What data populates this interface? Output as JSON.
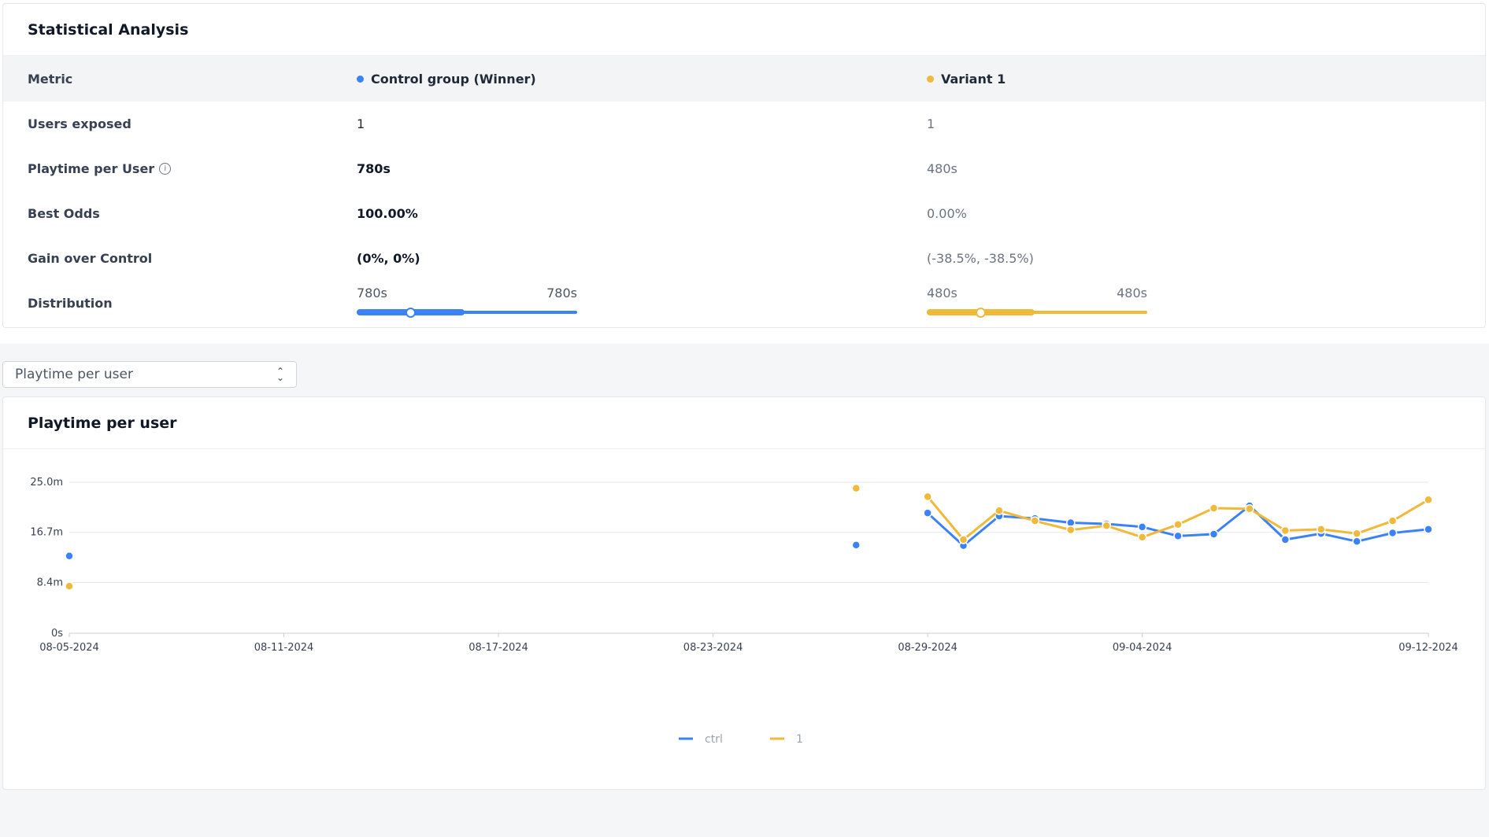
{
  "stats": {
    "title": "Statistical Analysis",
    "header": {
      "metric": "Metric",
      "control": "Control group (Winner)",
      "variant": "Variant 1"
    },
    "rows": [
      {
        "label": "Users exposed",
        "control": "1",
        "variant": "1"
      },
      {
        "label": "Playtime per User",
        "control": "780s",
        "variant": "480s"
      },
      {
        "label": "Best Odds",
        "control": "100.00%",
        "variant": "0.00%"
      },
      {
        "label": "Gain over Control",
        "control": "(0%, 0%)",
        "variant": "(-38.5%, -38.5%)"
      }
    ],
    "distribution": {
      "label": "Distribution",
      "control": {
        "low": "780s",
        "high": "780s"
      },
      "variant": {
        "low": "480s",
        "high": "480s"
      }
    }
  },
  "colors": {
    "control": "#3b82f6",
    "variant": "#f0b93a"
  },
  "select": {
    "value": "Playtime per user"
  },
  "chart": {
    "title": "Playtime per user"
  },
  "chart_data": {
    "type": "line",
    "title": "Playtime per user",
    "xlabel": "",
    "ylabel": "",
    "x_ticks": [
      "08-05-2024",
      "08-11-2024",
      "08-17-2024",
      "08-23-2024",
      "08-29-2024",
      "09-04-2024",
      "09-12-2024"
    ],
    "y_ticks": [
      "0s",
      "8.4m",
      "16.7m",
      "25.0m"
    ],
    "ylim": [
      0,
      25.0
    ],
    "y_unit": "m",
    "grid": true,
    "legend_position": "bottom-center",
    "series": [
      {
        "name": "ctrl",
        "points": [
          [
            "08-05-2024",
            12.8
          ],
          [
            "08-27-2024",
            14.6
          ],
          [
            "08-29-2024",
            19.9
          ],
          [
            "08-30-2024",
            14.5
          ],
          [
            "08-31-2024",
            19.4
          ],
          [
            "09-01-2024",
            19.0
          ],
          [
            "09-02-2024",
            18.3
          ],
          [
            "09-03-2024",
            18.1
          ],
          [
            "09-04-2024",
            17.6
          ],
          [
            "09-05-2024",
            16.1
          ],
          [
            "09-06-2024",
            16.4
          ],
          [
            "09-07-2024",
            21.1
          ],
          [
            "09-08-2024",
            15.5
          ],
          [
            "09-09-2024",
            16.5
          ],
          [
            "09-10-2024",
            15.2
          ],
          [
            "09-11-2024",
            16.6
          ],
          [
            "09-12-2024",
            17.2
          ]
        ]
      },
      {
        "name": "1",
        "points": [
          [
            "08-05-2024",
            7.8
          ],
          [
            "08-27-2024",
            24.0
          ],
          [
            "08-29-2024",
            22.6
          ],
          [
            "08-30-2024",
            15.5
          ],
          [
            "08-31-2024",
            20.3
          ],
          [
            "09-01-2024",
            18.6
          ],
          [
            "09-02-2024",
            17.1
          ],
          [
            "09-03-2024",
            17.8
          ],
          [
            "09-04-2024",
            15.9
          ],
          [
            "09-05-2024",
            18.0
          ],
          [
            "09-06-2024",
            20.7
          ],
          [
            "09-07-2024",
            20.6
          ],
          [
            "09-08-2024",
            17.0
          ],
          [
            "09-09-2024",
            17.2
          ],
          [
            "09-10-2024",
            16.5
          ],
          [
            "09-11-2024",
            18.6
          ],
          [
            "09-12-2024",
            22.1
          ]
        ]
      }
    ]
  }
}
